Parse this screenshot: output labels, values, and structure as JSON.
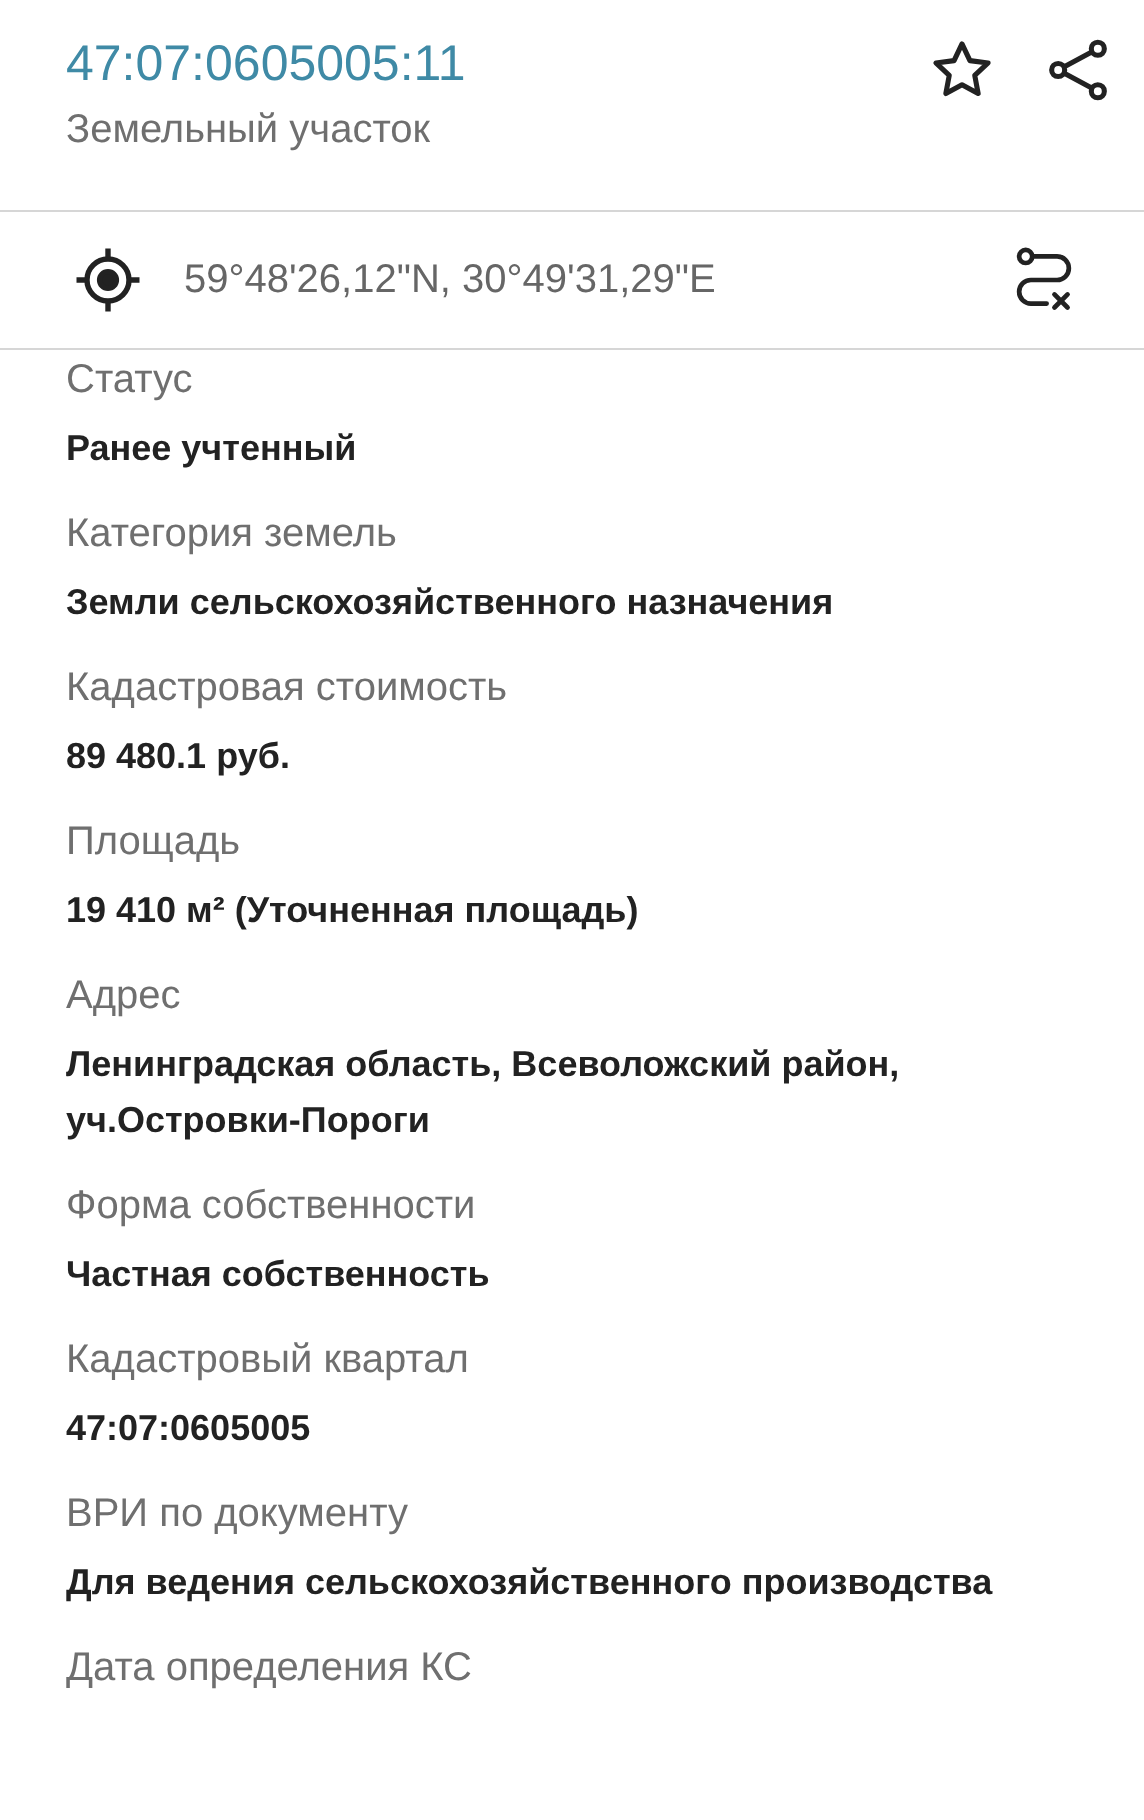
{
  "header": {
    "title": "47:07:0605005:11",
    "subtitle": "Земельный участок",
    "favorite": false
  },
  "coordinates": "59°48'26,12\"N, 30°49'31,29\"E",
  "fields": [
    {
      "label": "Статус",
      "value": "Ранее учтенный"
    },
    {
      "label": "Категория земель",
      "value": "Земли сельскохозяйственного назначения"
    },
    {
      "label": "Кадастровая стоимость",
      "value": "89 480.1 руб."
    },
    {
      "label": "Площадь",
      "value": "19 410 м² (Уточненная площадь)"
    },
    {
      "label": "Адрес",
      "value": "Ленинградская область, Всеволожский район, уч.Островки-Пороги"
    },
    {
      "label": "Форма собственности",
      "value": "Частная собственность"
    },
    {
      "label": "Кадастровый квартал",
      "value": "47:07:0605005"
    },
    {
      "label": "ВРИ по документу",
      "value": "Для ведения сельскохозяйственного производства"
    },
    {
      "label": "Дата определения КС"
    }
  ]
}
